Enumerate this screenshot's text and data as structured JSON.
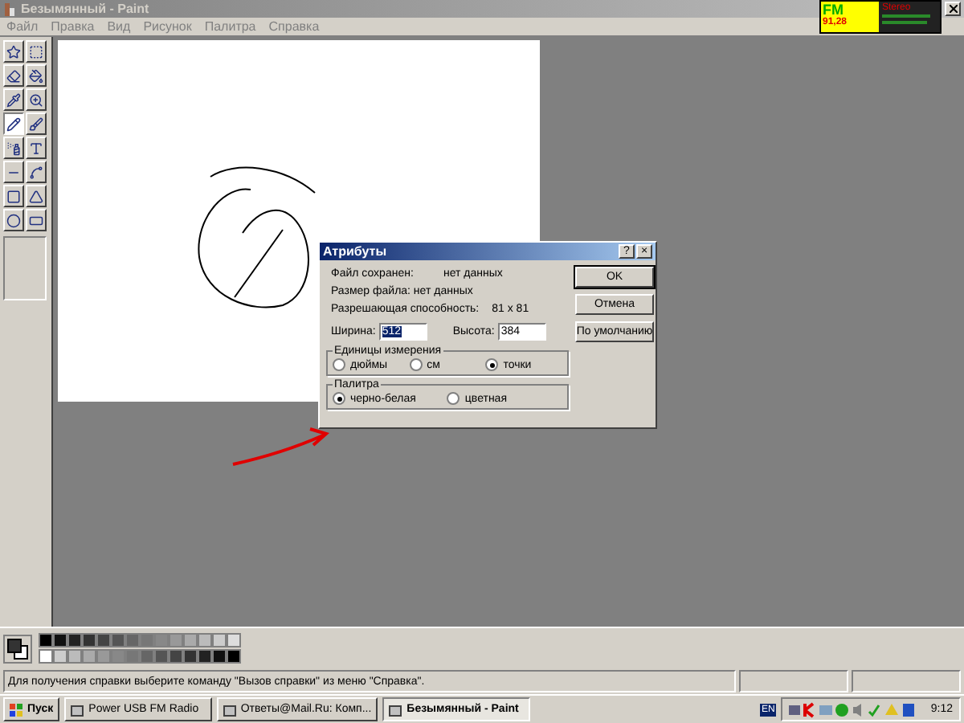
{
  "window": {
    "title": "Безымянный - Paint"
  },
  "fm_widget": {
    "band": "FM",
    "frequency": "91,28",
    "mode": "Stereo"
  },
  "menu": [
    "Файл",
    "Правка",
    "Вид",
    "Рисунок",
    "Палитра",
    "Справка"
  ],
  "tools": [
    {
      "selected": false
    },
    {
      "selected": false
    },
    {
      "selected": false
    },
    {
      "selected": false
    },
    {
      "selected": false
    },
    {
      "selected": false
    },
    {
      "selected": true
    },
    {
      "selected": false
    },
    {
      "selected": false
    },
    {
      "selected": false
    },
    {
      "selected": false
    },
    {
      "selected": false
    },
    {
      "selected": false
    },
    {
      "selected": false
    },
    {
      "selected": false
    },
    {
      "selected": false
    }
  ],
  "dialog": {
    "title": "Атрибуты",
    "help": "?",
    "close": "×",
    "info": [
      {
        "label": "Файл сохранен:",
        "value": "нет данных"
      },
      {
        "label": "Размер файла: нет данных"
      },
      {
        "label": "Разрешающая способность:",
        "value": "81 x 81"
      }
    ],
    "fields": [
      {
        "label": "Ширина:",
        "value": "512",
        "text_selected": true
      },
      {
        "label": "Высота:",
        "value": "384",
        "text_selected": false
      }
    ],
    "groups": [
      {
        "title": "Единицы измерения",
        "options": [
          {
            "label": "дюймы",
            "selected": false
          },
          {
            "label": "см",
            "selected": false
          },
          {
            "label": "точки",
            "selected": true
          }
        ]
      },
      {
        "title": "Палитра",
        "options": [
          {
            "label": "черно-белая",
            "selected": true
          },
          {
            "label": "цветная",
            "selected": false
          }
        ]
      }
    ],
    "buttons": [
      {
        "label": "OK",
        "default": true
      },
      {
        "label": "Отмена",
        "default": false
      },
      {
        "label": "По умолчанию",
        "default": false
      }
    ]
  },
  "status_bar": {
    "text": "Для получения справки выберите команду \"Вызов справки\" из меню \"Справка\"."
  },
  "taskbar": {
    "start": "Пуск",
    "tasks": [
      {
        "label": "Power USB FM Radio",
        "selected": false
      },
      {
        "label": "Ответы@Mail.Ru: Комп...",
        "selected": false
      },
      {
        "label": "Безымянный - Paint",
        "selected": true
      }
    ],
    "language": "EN",
    "clock": "9:12"
  }
}
